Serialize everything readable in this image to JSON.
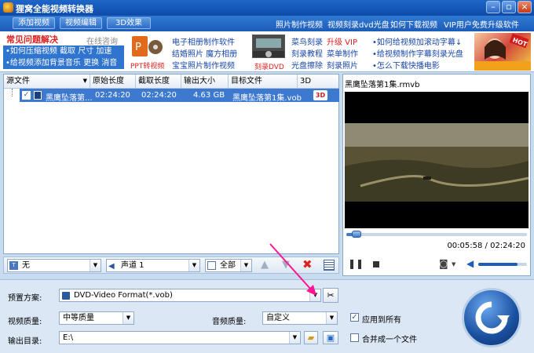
{
  "app": {
    "title": "狸窝全能视频转换器"
  },
  "toolbar": {
    "add_video": "添加视频",
    "edit_video": "视频编辑",
    "effect_3d": "3D效果",
    "links": [
      "照片制作视频",
      "视频刻录dvd光盘",
      "如何下载视频",
      "VIP用户免费升级软件"
    ]
  },
  "promo": {
    "faq_title": "常见问题解决",
    "consult": "在线咨询",
    "line1": "•如何压缩视频  截取  尺寸  加速",
    "line2": "•给视频添加背景音乐",
    "line2b": "更换",
    "line2c": "消音",
    "ppt_label": "PPT转视频",
    "album": [
      "电子相册制作软件",
      "结婚照片  魔方相册",
      "宝宝照片制作视频"
    ],
    "burn_label": "刻录DVD",
    "burn_col1": [
      "菜鸟刻录",
      "刻录教程",
      "光盘擦除"
    ],
    "vip": "升级 VIP",
    "burn_col2": [
      "菜单制作",
      "刻录照片"
    ],
    "right_links": [
      "•如何给视频加滚动字幕↓",
      "•给视频制作字幕刻录光盘",
      "•怎么下载快播电影"
    ],
    "hot": "HOT"
  },
  "filelist": {
    "columns": [
      "源文件",
      "原始长度",
      "截取长度",
      "输出大小",
      "目标文件",
      "3D"
    ],
    "rows": [
      {
        "name": "黑鹰坠落第...",
        "orig": "02:24:20",
        "cut": "02:24:20",
        "size": "4.63 GB",
        "target": "黑鹰坠落第1集.vob",
        "badge": "3D"
      }
    ]
  },
  "preview": {
    "filename": "黑鹰坠落第1集.rmvb",
    "time": "00:05:58 / 02:24:20",
    "progress": 0.04,
    "volume": 0.8
  },
  "bottombar": {
    "subtitle": "无",
    "audio": "声道 1",
    "apply": "全部"
  },
  "settings": {
    "preset_label": "预置方案:",
    "preset_value": "DVD-Video Format(*.vob)",
    "vquality_label": "视频质量:",
    "vquality_value": "中等质量",
    "aquality_label": "音频质量:",
    "aquality_value": "自定义",
    "apply_all": "应用到所有",
    "output_label": "输出目录:",
    "output_value": "E:\\",
    "merge": "合并成一个文件"
  },
  "colors": {
    "accent": "#1d5cb8",
    "selection": "#3d79cf",
    "annotation": "#ff1493"
  }
}
